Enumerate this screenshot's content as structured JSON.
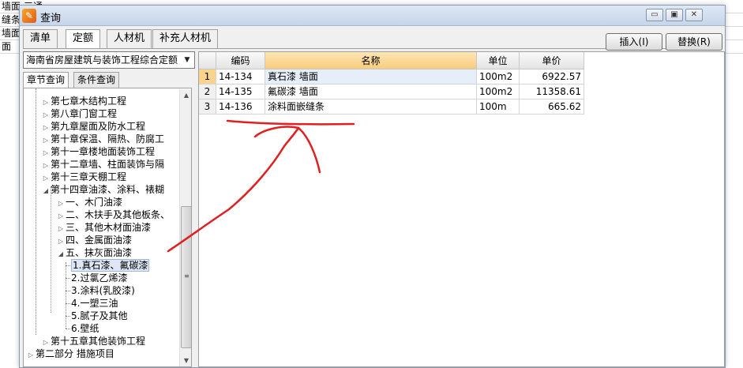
{
  "background": {
    "rows": [
      {
        "left": "墙面",
        "mid": "三通"
      },
      {
        "left": "缝条",
        "mid": ""
      },
      {
        "left": "墙面",
        "mid": ""
      },
      {
        "left": "面",
        "mid": ""
      }
    ]
  },
  "window": {
    "title": "查询",
    "icon_glyph": "✎",
    "minimize_glyph": "▭",
    "restore_glyph": "▣",
    "close_glyph": "✕"
  },
  "tabs": [
    {
      "label": "清单"
    },
    {
      "label": "定额"
    },
    {
      "label": "人材机"
    },
    {
      "label": "补充人材机"
    }
  ],
  "buttons": {
    "insert": "插入(I)",
    "replace": "替换(R)"
  },
  "left_panel": {
    "quota_selected": "海南省房屋建筑与装饰工程综合定额",
    "dropdown_glyph": "▼",
    "sub_tabs": [
      {
        "label": "章节查询"
      },
      {
        "label": "条件查询"
      }
    ],
    "tree": [
      {
        "label": "第七章木结构工程",
        "expander": "▷"
      },
      {
        "label": "第八章门窗工程",
        "expander": "▷"
      },
      {
        "label": "第九章屋面及防水工程",
        "expander": "▷"
      },
      {
        "label": "第十章保温、隔热、防腐工",
        "expander": "▷"
      },
      {
        "label": "第十一章楼地面装饰工程",
        "expander": "▷"
      },
      {
        "label": "第十二章墙、柱面装饰与隔",
        "expander": "▷"
      },
      {
        "label": "第十三章天棚工程",
        "expander": "▷"
      },
      {
        "label": "第十四章油漆、涂料、裱糊",
        "expander": "◢"
      },
      {
        "label": "一、木门油漆",
        "expander": "▷"
      },
      {
        "label": "二、木扶手及其他板条、",
        "expander": "▷"
      },
      {
        "label": "三、其他木材面油漆",
        "expander": "▷"
      },
      {
        "label": "四、金属面油漆",
        "expander": "▷"
      },
      {
        "label": "五、抹灰面油漆",
        "expander": "◢"
      },
      {
        "label": "1.真石漆、氟碳漆",
        "expander": ""
      },
      {
        "label": "2.过氯乙烯漆",
        "expander": ""
      },
      {
        "label": "3.涂料(乳胶漆)",
        "expander": ""
      },
      {
        "label": "4.一塑三油",
        "expander": ""
      },
      {
        "label": "5.腻子及其他",
        "expander": ""
      },
      {
        "label": "6.壁纸",
        "expander": ""
      },
      {
        "label": "第十五章其他装饰工程",
        "expander": "▷"
      },
      {
        "label": "第二部分 措施项目",
        "expander": "▷"
      }
    ],
    "scroll_up": "▲",
    "scroll_down": "▼",
    "grip": "≡"
  },
  "grid": {
    "columns": [
      "编码",
      "名称",
      "单位",
      "单价"
    ],
    "rows": [
      {
        "n": "1",
        "code": "14-134",
        "name": "真石漆 墙面",
        "unit": "100m2",
        "price": "6922.57"
      },
      {
        "n": "2",
        "code": "14-135",
        "name": "氟碳漆 墙面",
        "unit": "100m2",
        "price": "11358.61"
      },
      {
        "n": "3",
        "code": "14-136",
        "name": "涂料面嵌缝条",
        "unit": "100m",
        "price": "665.62"
      }
    ]
  },
  "colors": {
    "annotation": "#e02020",
    "header_highlight": "#f7cc7c",
    "selection": "#dde7f5"
  }
}
